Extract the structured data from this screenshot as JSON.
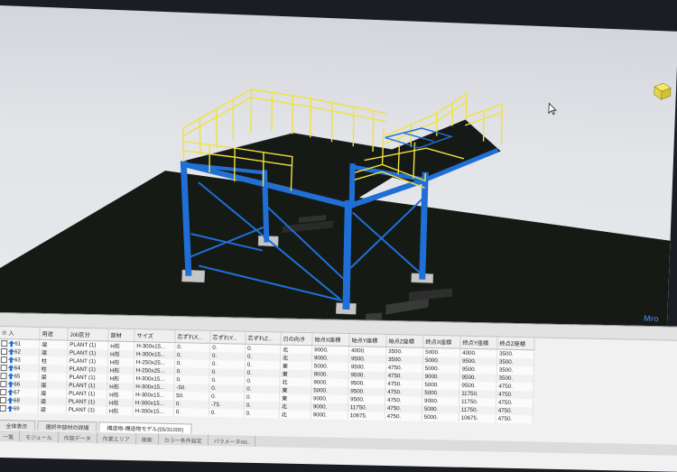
{
  "viewport": {
    "corner_logo": "Mro"
  },
  "table": {
    "columns": [
      "※ 入",
      "用途",
      "Job区分",
      "部材",
      "サイズ",
      "芯ずれX...",
      "芯ずれY...",
      "芯ずれZ...",
      "刃の向き",
      "始点X座標",
      "始点Y座標",
      "始点Z座標",
      "終点X座標",
      "終点Y座標",
      "終点Z座標"
    ],
    "rows": [
      {
        "no": "61",
        "use": "梁",
        "job": "PLANT (1)",
        "member": "H形",
        "size": "H-300x15...",
        "ox": "0.",
        "oy": "0.",
        "oz": "0.",
        "dir": "北",
        "sx": "9000.",
        "sy": "4000.",
        "sz": "3500.",
        "ex": "5000.",
        "ey": "4000.",
        "ez": "3500."
      },
      {
        "no": "62",
        "use": "梁",
        "job": "PLANT (1)",
        "member": "H形",
        "size": "H-300x15...",
        "ox": "0.",
        "oy": "0.",
        "oz": "0.",
        "dir": "北",
        "sx": "9000.",
        "sy": "9500.",
        "sz": "3500.",
        "ex": "5000.",
        "ey": "9500.",
        "ez": "3500."
      },
      {
        "no": "63",
        "use": "柱",
        "job": "PLANT (1)",
        "member": "H形",
        "size": "H-250x25...",
        "ox": "0.",
        "oy": "0.",
        "oz": "0.",
        "dir": "東",
        "sx": "5000.",
        "sy": "9500.",
        "sz": "4750.",
        "ex": "5000.",
        "ey": "9500.",
        "ez": "3500."
      },
      {
        "no": "64",
        "use": "柱",
        "job": "PLANT (1)",
        "member": "H形",
        "size": "H-250x25...",
        "ox": "0.",
        "oy": "0.",
        "oz": "0.",
        "dir": "東",
        "sx": "9000.",
        "sy": "9500.",
        "sz": "4750.",
        "ex": "9000.",
        "ey": "9500.",
        "ez": "3500."
      },
      {
        "no": "65",
        "use": "梁",
        "job": "PLANT (1)",
        "member": "H形",
        "size": "H-300x15...",
        "ox": "0.",
        "oy": "0.",
        "oz": "0.",
        "dir": "北",
        "sx": "9000.",
        "sy": "9500.",
        "sz": "4750.",
        "ex": "5000.",
        "ey": "9500.",
        "ez": "4750."
      },
      {
        "no": "66",
        "use": "梁",
        "job": "PLANT (1)",
        "member": "H形",
        "size": "H-300x15...",
        "ox": "-50.",
        "oy": "0.",
        "oz": "0.",
        "dir": "東",
        "sx": "5000.",
        "sy": "9500.",
        "sz": "4750.",
        "ex": "5000.",
        "ey": "11750.",
        "ez": "4750."
      },
      {
        "no": "67",
        "use": "梁",
        "job": "PLANT (1)",
        "member": "H形",
        "size": "H-300x15...",
        "ox": "50.",
        "oy": "0.",
        "oz": "0.",
        "dir": "東",
        "sx": "9000.",
        "sy": "9500.",
        "sz": "4750.",
        "ex": "9000.",
        "ey": "11750.",
        "ez": "4750."
      },
      {
        "no": "68",
        "use": "梁",
        "job": "PLANT (1)",
        "member": "H形",
        "size": "H-300x15...",
        "ox": "0.",
        "oy": "-75.",
        "oz": "0.",
        "dir": "北",
        "sx": "9000.",
        "sy": "11750.",
        "sz": "4750.",
        "ex": "5000.",
        "ey": "11750.",
        "ez": "4750."
      },
      {
        "no": "69",
        "use": "梁",
        "job": "PLANT (1)",
        "member": "H形",
        "size": "H-300x15...",
        "ox": "0.",
        "oy": "0.",
        "oz": "0.",
        "dir": "北",
        "sx": "9000.",
        "sy": "10675.",
        "sz": "4750.",
        "ex": "5000.",
        "ey": "10675.",
        "ez": "4750."
      }
    ]
  },
  "tabs": [
    "全体表示",
    "選択中部材の詳細",
    "構造物-構造物モデル(55/31000)"
  ],
  "statusbar": [
    "一覧",
    "モジュール",
    "作図データ",
    "作業エリア",
    "検索",
    "カラー条件設定",
    "パラメータetc."
  ],
  "colors": {
    "steel": "#1f6fd6",
    "railing": "#f0e23c",
    "floor": "#151a15",
    "ground": "#151a15",
    "footing": "#bdbdbd"
  }
}
